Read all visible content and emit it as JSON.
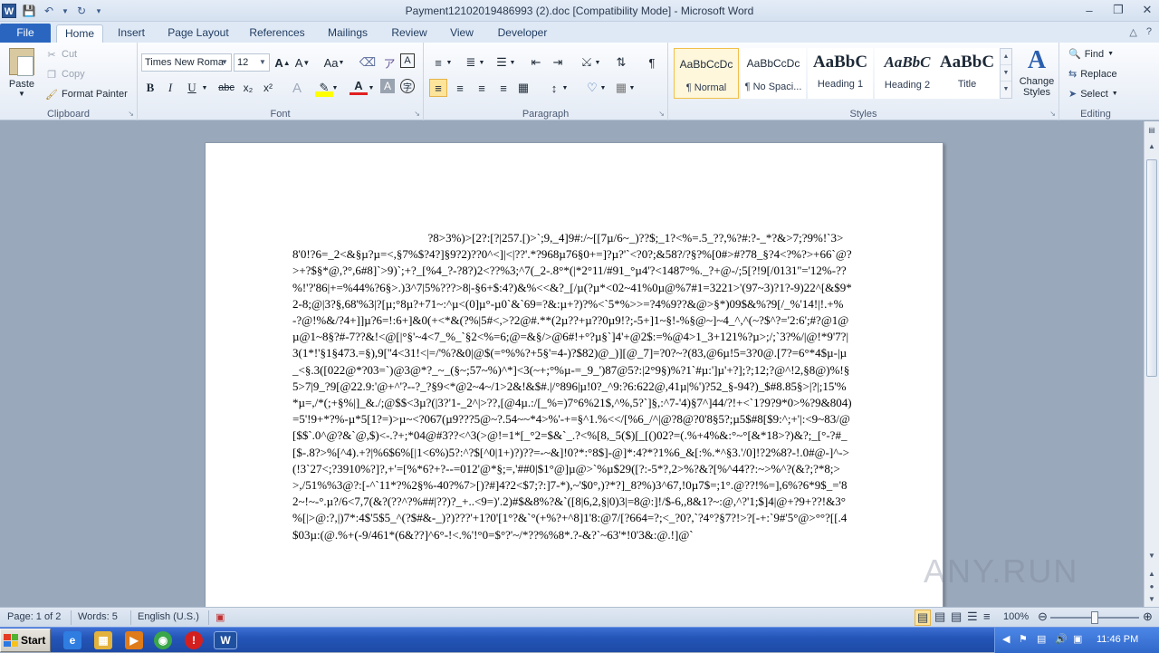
{
  "window": {
    "title": "Payment12102019486993 (2).doc [Compatibility Mode]  -  Microsoft Word"
  },
  "quick_access": {
    "app_icon": "word-icon",
    "save_icon": "save-icon",
    "undo_icon": "undo-icon",
    "redo_icon": "redo-icon",
    "customize_icon": "customize-qat-icon"
  },
  "tabs": [
    {
      "label": "File"
    },
    {
      "label": "Home"
    },
    {
      "label": "Insert"
    },
    {
      "label": "Page Layout"
    },
    {
      "label": "References"
    },
    {
      "label": "Mailings"
    },
    {
      "label": "Review"
    },
    {
      "label": "View"
    },
    {
      "label": "Developer"
    }
  ],
  "clipboard": {
    "label": "Clipboard",
    "paste": "Paste",
    "cut": "Cut",
    "copy": "Copy",
    "format_painter": "Format Painter"
  },
  "font": {
    "label": "Font",
    "family": "Times New Roma",
    "size": "12",
    "bold": "B",
    "italic": "I",
    "underline": "U",
    "strike": "abc",
    "subscript": "x₂",
    "superscript": "x²"
  },
  "paragraph": {
    "label": "Paragraph"
  },
  "styles": {
    "label": "Styles",
    "items": [
      {
        "preview": "AaBbCcDc",
        "name": "¶ Normal"
      },
      {
        "preview": "AaBbCcDc",
        "name": "¶ No Spaci..."
      },
      {
        "preview": "AaBbC",
        "name": "Heading 1"
      },
      {
        "preview": "AaBbC",
        "name": "Heading 2"
      },
      {
        "preview": "AaBbC",
        "name": "Title"
      }
    ],
    "change_styles": "Change Styles"
  },
  "editing": {
    "label": "Editing",
    "find": "Find",
    "replace": "Replace",
    "select": "Select"
  },
  "document": {
    "body": "                                              ?8>3%)>[2?:[?|257.[)>`;9,_4]9#:/~[[7µ/6~_)??$;_1?<%=.5_??,%?#:?-_*?&>7;?9%!`3>8'0!?6=_2<&§µ?µ=<,§7%$?4?]§9?2)??0^<]|<|??'.*?968µ76§0+=]?µ?'`<?0?;&58?/?§?%[0#>#?78_§?4<?%?>+66`@?>+?$§*@,?°,6#8]`>9)`;+?_[%4_?-?8?)2<??%3;^7(_2-.8°*(|*2°11/#91_°µ4'?<1487°%._?+@-/;5[?!9[/0131''='12%-??%!'?'86|+=%44%?6§>.)3^7|5%???>8|-§6+$:4?)&%<<&?_[/µ(?µ*<02~41%0µ@%7#1=3221>'(97~3)?1?-9)22^[&$9*2-8;@|3?§,68'%3|?[µ;°8µ?+71~:^µ<(0]µ°-µ0`&`69=?&:µ+?)?%<`5*%>>=?4%9??&@>§*)09$&%?9[/_%'14!|!.+%-?@!%&/?4+]]µ?6=!:6+]&0(+<*&(?%|5#<,>?2@#.**(2µ??+µ??0µ9!?;-5+]1~§!-%§@~]~4_^,^(~?$^?='2:6';#?@1@µ@1~8§?#-7??&!<@[|°§'~4<7_%_`§2<%=6;@=&§/>@6#!+°?µ§`]4'+@2$:=%@4>1_3+121%?µ>;/;`3?%/|@!*9'7?|3(1*!'§1§473.=§),9[''4<31!<|=/'%?&0|@$(=°%%?+5§'=4-)?$82)@_)][@_7]=?0?~?(83,@6µ!5=3?0@.[7?=6°*4$µ-|µ_<§.3([022@*?03=`)@3@*?_~_(§~;57~%)^*]<3(~+;°%µ-=_9_')87@5?:|2°9§)%?1`#µ:']µ'+?];?;12;?@^!2,§8@)%!§5>7|9_?9[@22.9:'@+^'?--?_?§9<*@2~4~/1>2&!&$#.|/°896|µ!0?_^9:?6:622@,41µ|%')?52_§-94?)_$#8.85§>|?|;15'%*µ=,/*(;+§%|]_&./;@$$<3µ?(|3?'1-_2^|>??,[@4µ.:/[_%=)7°6%21$,^%,5?`]§,:^7-'4)§7^]44/?!+<`1?9?9*0>%?9&804)=5'!9+*?%-µ*5[1?=)>µ~<?067(µ9???5@~?.54~~*4>%'-+=§^1.%<</[%6_/^|@?8@?0'8§5?;µ5$#8[$9:^;+'|:<9~83/@[$$`.0^@?&`@,$)<-.?+;*04@#3??<^3(>@!=1*[_°2=$&`_.?<%[8,_5($)[_[()02?=(.%+4%&:°~°[&*18>?)&?;_[°-?#_[$-.8?>%[^4).+?|%6$6%[|1<6%)5?:^?$[^0|1+)?)??=-~&]!0?*:°8$]-@]*:4?*?1%6_&[:%.*^§3.'/0]!?2%8?-!.0#@-]^->(!3`27<;?3910%?]?,+'=[%*6?+?--=012'@*§;=,'##0|$1°@]µ@>`%µ$29([?:-5*?,2>%?&?[%^44??:~>%^?(&?;?*8;>>,/51%%3@?:[-^`11*?%2§%-40?%7>[)?#]4?2<$7;?:]7-*),~'$0°,)?*?]_8?%)3^67,!0µ7$=;1°.@??!%=],6%?6*9$_='82~!~-°.µ?/6<7,7(&?(??^?%##|??)?_+..<9=)'.2)#$&8%?&`([8|6,2,§|0)3|=8@:]!/$-6,,8&1?~:@,^?'1;$]4|@+?9+??!&3°%[|>@:?,|)7*:4$'5$5_^(?$#&-_)?)???'+1?0'[1°?&`°(+%?+^8]1'8:@7/[?664=?;<_?0?,`?4°?§7?!>?[-+:`9#'5°@>°°?[[.4$03µ:(@.%+(-9/461*(6&??]^6°-!<.%'!°0=$°?'~/*??%%8*.?-&?`~63'*!0'3&:@.!]@`"
  },
  "watermark": "ANY.RUN",
  "status": {
    "page": "Page: 1 of 2",
    "words": "Words: 5",
    "language": "English (U.S.)",
    "zoom": "100%",
    "zoom_fraction": 0.5
  },
  "taskbar": {
    "start": "Start",
    "clock": "11:46 PM"
  }
}
